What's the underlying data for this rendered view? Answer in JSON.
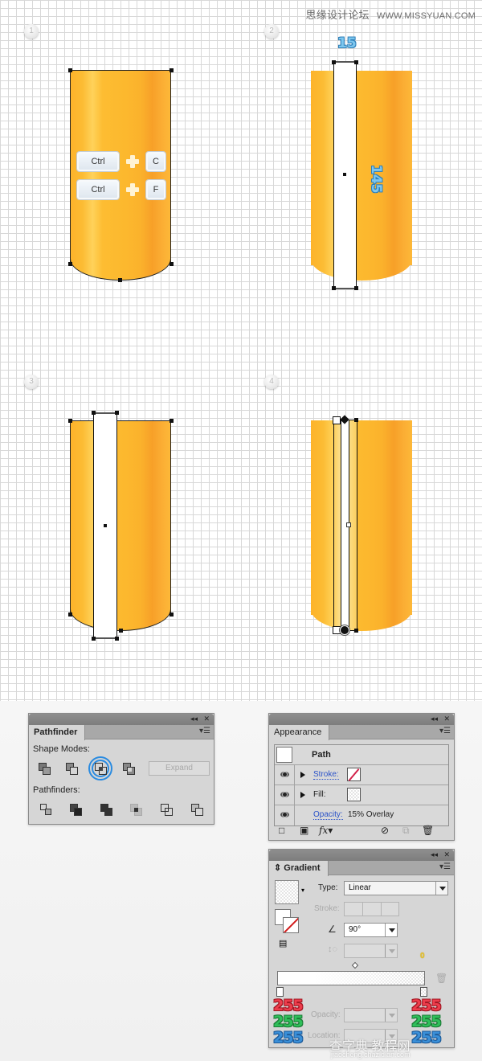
{
  "watermark_top": {
    "cn": "思缘设计论坛",
    "url": "WWW.MISSYUAN.COM"
  },
  "steps": [
    {
      "number": "1"
    },
    {
      "number": "2"
    },
    {
      "number": "3"
    },
    {
      "number": "4"
    }
  ],
  "step1": {
    "shortcuts": [
      {
        "modifier": "Ctrl",
        "key": "C"
      },
      {
        "modifier": "Ctrl",
        "key": "F"
      }
    ]
  },
  "step2": {
    "width_label": "15",
    "height_label": "145"
  },
  "colors": {
    "cylinder_orange": "#fcb82e",
    "selection": "#111111",
    "measure_blue": "#7dc7ef",
    "highlight_ring": "#2a8be0"
  },
  "pathfinder": {
    "title": "Pathfinder",
    "shape_modes_label": "Shape Modes:",
    "shape_modes": [
      "unite-icon",
      "minus-front-icon",
      "intersect-icon",
      "exclude-icon"
    ],
    "active_shape_mode": "intersect",
    "expand_label": "Expand",
    "pathfinders_label": "Pathfinders:",
    "pathfinders": [
      "divide-icon",
      "trim-icon",
      "merge-icon",
      "crop-icon",
      "outline-icon",
      "minus-back-icon"
    ]
  },
  "appearance": {
    "title": "Appearance",
    "object_label": "Path",
    "rows": [
      {
        "label": "Stroke:",
        "linked": true,
        "swatch": "none"
      },
      {
        "label": "Fill:",
        "linked": false,
        "swatch": "gradient"
      },
      {
        "label": "Opacity:",
        "linked": true,
        "value": "15% Overlay"
      }
    ]
  },
  "gradient": {
    "title": "Gradient",
    "type_label": "Type:",
    "type_value": "Linear",
    "stroke_label": "Stroke:",
    "angle_value": "90°",
    "midpoint_badge": "0",
    "opacity_label": "Opacity:",
    "location_label": "Location:",
    "stops": [
      {
        "r": "255",
        "g": "255",
        "b": "255"
      },
      {
        "r": "255",
        "g": "255",
        "b": "255"
      }
    ]
  },
  "watermark_bottom": {
    "cn": "查字典 教程网",
    "url": "jiaocheng.chazidian.com"
  }
}
